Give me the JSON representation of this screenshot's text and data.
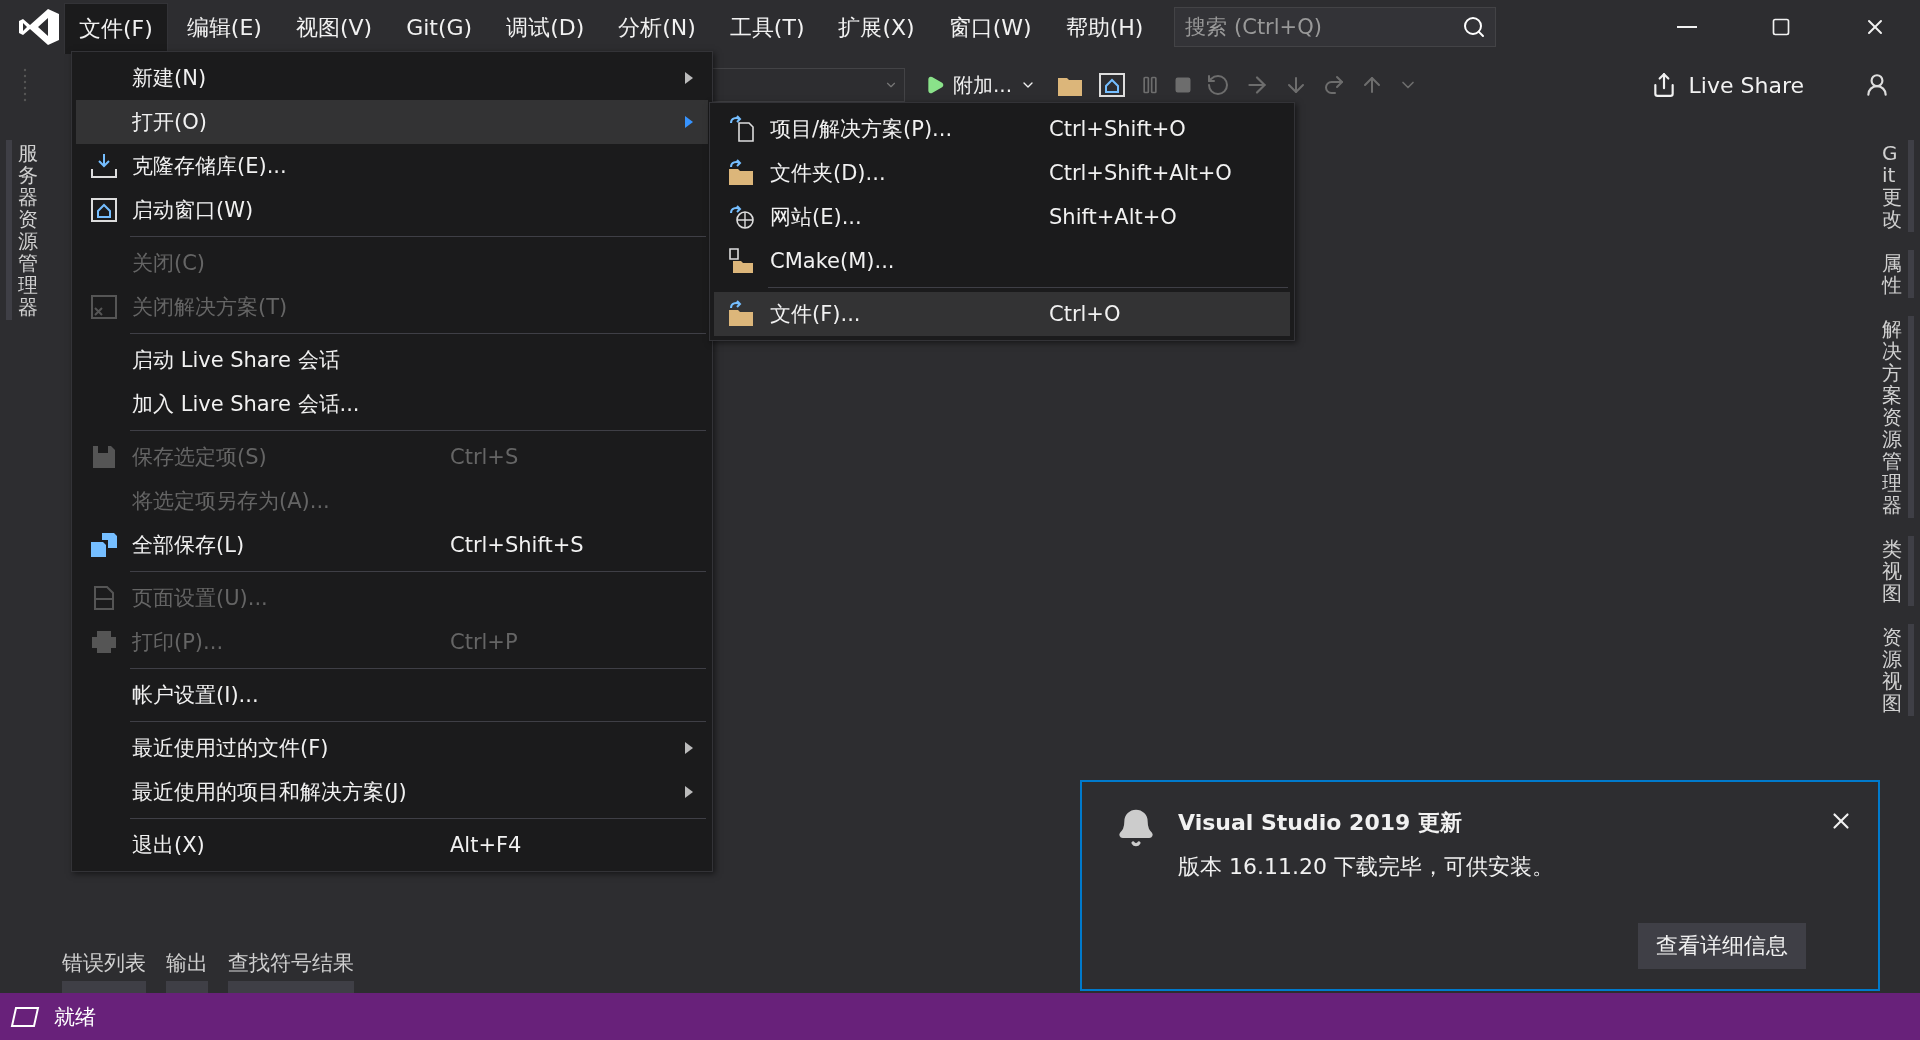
{
  "title_bar": {
    "menus": [
      {
        "label": "文件(F)",
        "selected": true
      },
      {
        "label": "编辑(E)",
        "selected": false
      },
      {
        "label": "视图(V)",
        "selected": false
      },
      {
        "label": "Git(G)",
        "selected": false
      },
      {
        "label": "调试(D)",
        "selected": false
      },
      {
        "label": "分析(N)",
        "selected": false
      },
      {
        "label": "工具(T)",
        "selected": false
      },
      {
        "label": "扩展(X)",
        "selected": false
      },
      {
        "label": "窗口(W)",
        "selected": false
      },
      {
        "label": "帮助(H)",
        "selected": false
      }
    ],
    "search": {
      "placeholder": "搜索 (Ctrl+Q)"
    }
  },
  "toolbar": {
    "run_label": "附加...",
    "live_share": "Live Share"
  },
  "left_tabs": [
    "服务器资源管理器"
  ],
  "right_tabs": [
    "Git 更改",
    "属性",
    "解决方案资源管理器",
    "类视图",
    "资源视图"
  ],
  "file_menu": {
    "groups": [
      [
        {
          "label": "新建(N)",
          "disabled": false,
          "submenu": true,
          "selected": false
        },
        {
          "label": "打开(O)",
          "disabled": false,
          "submenu": true,
          "selected": true
        },
        {
          "label": "克隆存储库(E)...",
          "disabled": false,
          "submenu": false,
          "selected": false
        },
        {
          "label": "启动窗口(W)",
          "disabled": false,
          "submenu": false,
          "selected": false
        }
      ],
      [
        {
          "label": "关闭(C)",
          "disabled": true,
          "submenu": false,
          "selected": false
        },
        {
          "label": "关闭解决方案(T)",
          "disabled": true,
          "submenu": false,
          "selected": false
        }
      ],
      [
        {
          "label": "启动 Live Share 会话",
          "disabled": false,
          "submenu": false,
          "selected": false
        },
        {
          "label": "加入 Live Share 会话...",
          "disabled": false,
          "submenu": false,
          "selected": false
        }
      ],
      [
        {
          "label": "保存选定项(S)",
          "shortcut": "Ctrl+S",
          "disabled": true,
          "submenu": false,
          "selected": false
        },
        {
          "label": "将选定项另存为(A)...",
          "disabled": true,
          "submenu": false,
          "selected": false
        },
        {
          "label": "全部保存(L)",
          "shortcut": "Ctrl+Shift+S",
          "disabled": false,
          "submenu": false,
          "selected": false
        }
      ],
      [
        {
          "label": "页面设置(U)...",
          "disabled": true,
          "submenu": false,
          "selected": false
        },
        {
          "label": "打印(P)...",
          "shortcut": "Ctrl+P",
          "disabled": true,
          "submenu": false,
          "selected": false
        }
      ],
      [
        {
          "label": "帐户设置(I)...",
          "disabled": false,
          "submenu": false,
          "selected": false
        }
      ],
      [
        {
          "label": "最近使用过的文件(F)",
          "disabled": false,
          "submenu": true,
          "selected": false
        },
        {
          "label": "最近使用的项目和解决方案(J)",
          "disabled": false,
          "submenu": true,
          "selected": false
        }
      ],
      [
        {
          "label": "退出(X)",
          "shortcut": "Alt+F4",
          "disabled": false,
          "submenu": false,
          "selected": false
        }
      ]
    ]
  },
  "open_submenu": {
    "groups": [
      [
        {
          "label": "项目/解决方案(P)...",
          "shortcut": "Ctrl+Shift+O",
          "selected": false
        },
        {
          "label": "文件夹(D)...",
          "shortcut": "Ctrl+Shift+Alt+O",
          "selected": false
        },
        {
          "label": "网站(E)...",
          "shortcut": "Shift+Alt+O",
          "selected": false
        },
        {
          "label": "CMake(M)...",
          "selected": false
        }
      ],
      [
        {
          "label": "文件(F)...",
          "shortcut": "Ctrl+O",
          "selected": true
        }
      ]
    ]
  },
  "bottom_tabs": [
    "错误列表",
    "输出",
    "查找符号结果"
  ],
  "notification": {
    "title": "Visual Studio 2019 更新",
    "message": "版本 16.11.20 下载完毕，可供安装。",
    "button": "查看详细信息"
  },
  "status_bar": {
    "text": "就绪"
  }
}
